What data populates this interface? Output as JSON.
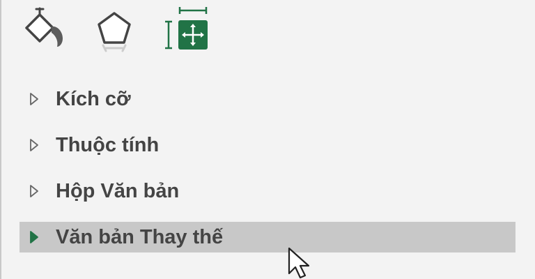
{
  "tabs": [
    {
      "name": "fill-line",
      "icon": "paint-bucket-icon"
    },
    {
      "name": "effects",
      "icon": "pentagon-icon"
    },
    {
      "name": "size-properties",
      "icon": "size-move-icon",
      "selected": true
    }
  ],
  "sections": [
    {
      "label": "Kích cỡ",
      "expanded": false
    },
    {
      "label": "Thuộc tính",
      "expanded": false
    },
    {
      "label": "Hộp Văn bản",
      "expanded": false
    },
    {
      "label": "Văn bản Thay thế",
      "expanded": false,
      "hovered": true
    }
  ],
  "colors": {
    "accent": "#217346",
    "hover_background": "#c8c8c8",
    "label_text": "#444444",
    "pane_background": "#f3f3f3"
  }
}
